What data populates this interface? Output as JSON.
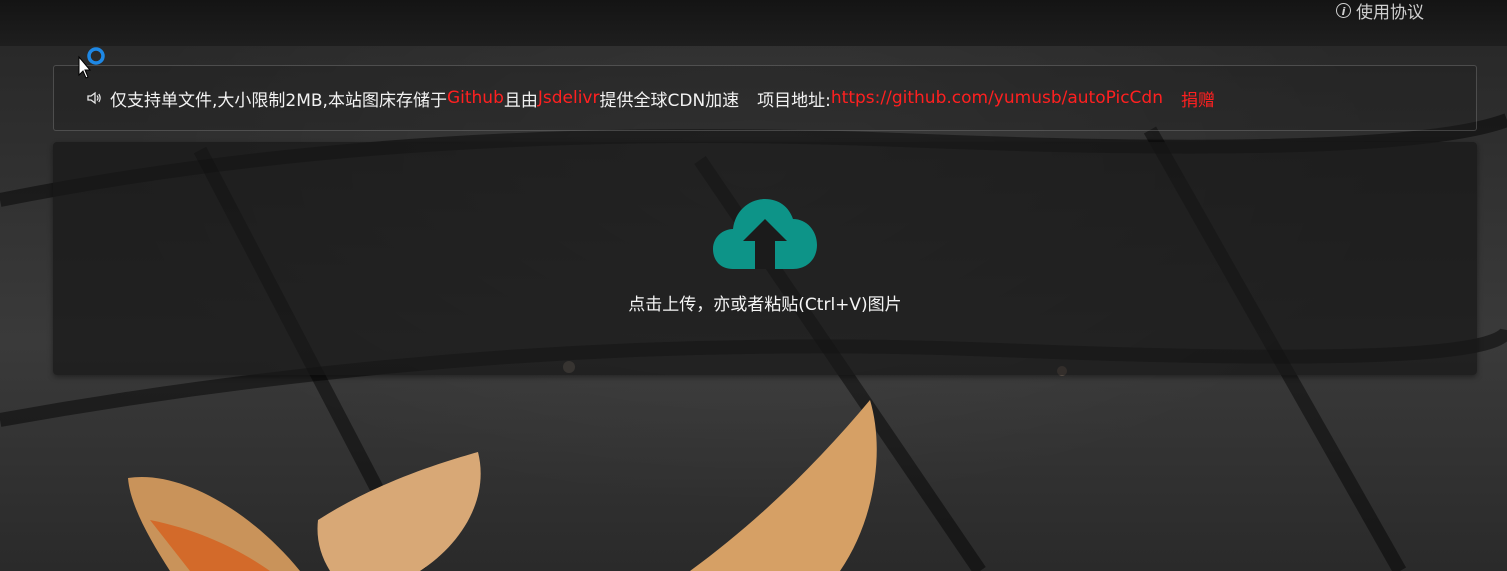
{
  "topbar": {
    "agreement_label": "使用协议",
    "agreement_icon": "info-icon"
  },
  "notice": {
    "icon": "speaker-icon",
    "text_1": "仅支持单文件,大小限制2MB,本站图床存储于",
    "github_label": "Github",
    "text_2": "且由",
    "jsdelivr_label": "Jsdelivr",
    "text_3": "提供全球CDN加速",
    "project_label": "项目地址:",
    "project_url": "https://github.com/yumusb/autoPicCdn",
    "donate_label": "捐赠",
    "highlight_color": "#ff2020"
  },
  "upload": {
    "icon": "cloud-upload-icon",
    "icon_color": "#0d9488",
    "hint": "点击上传，亦或者粘贴(Ctrl+V)图片"
  }
}
